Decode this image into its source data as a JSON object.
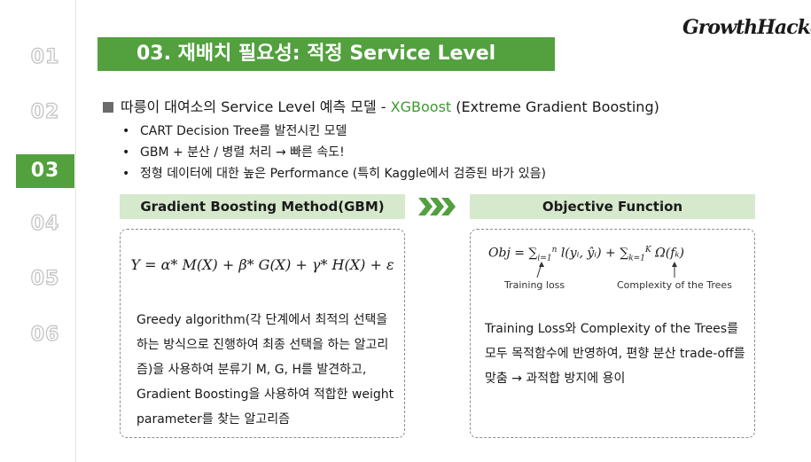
{
  "nav": {
    "items": [
      "01",
      "02",
      "03",
      "04",
      "05",
      "06"
    ],
    "active_index": 2,
    "active_color": "#52a03e"
  },
  "header": {
    "title": "03. 재배치 필요성: 적정 Service Level",
    "logo": "GrowthHackers"
  },
  "heading": {
    "prefix": "따릉이 대여소의 Service Level 예측 모델 - ",
    "accent": "XGBoost",
    "suffix": " (Extreme Gradient Boosting)"
  },
  "bullets": [
    "CART Decision Tree를 발전시킨 모델",
    "GBM + 분산 / 병렬 처리 → 빠른 속도!",
    "정형 데이터에 대한 높은 Performance (특히 Kaggle에서 검증된 바가 있음)"
  ],
  "left_panel": {
    "label": "Gradient Boosting Method(GBM)",
    "formula": "Y = α* M(X) + β* G(X) + γ* H(X) + ε",
    "description": "Greedy algorithm(각 단계에서 최적의 선택을 하는 방식으로 진행하여 최종 선택을 하는 알고리즘)을 사용하여 분류기 M, G, H를 발견하고, Gradient Boosting을 사용하여 적합한 weight parameter를 찾는 알고리즘"
  },
  "right_panel": {
    "label": "Objective Function",
    "formula": "Obj = Σ l(yᵢ, ŷᵢ) + Σ Ω(fₖ)",
    "formula_parts": {
      "lhs": "Obj = ",
      "sum1": "∑",
      "sum1_sub": "i=1",
      "sum1_sup": "n",
      "term1": " l(yᵢ, ŷᵢ) + ",
      "sum2": "∑",
      "sum2_sub": "k=1",
      "sum2_sup": "K",
      "term2": " Ω(fₖ)"
    },
    "training_loss_label": "Training loss",
    "complexity_label": "Complexity of the Trees",
    "description": "Training Loss와 Complexity of the Trees를 모두 목적함수에 반영하여, 편향 분산 trade-off를 맞춤 → 과적합 방지에 용이"
  },
  "colors": {
    "brand_green": "#52a03e",
    "label_bg": "#d6e9cd",
    "accent_text": "#3d9a2c"
  },
  "icons": {
    "arrow": "triple-chevron-right-icon",
    "heading_marker": "square-bullet-icon"
  }
}
